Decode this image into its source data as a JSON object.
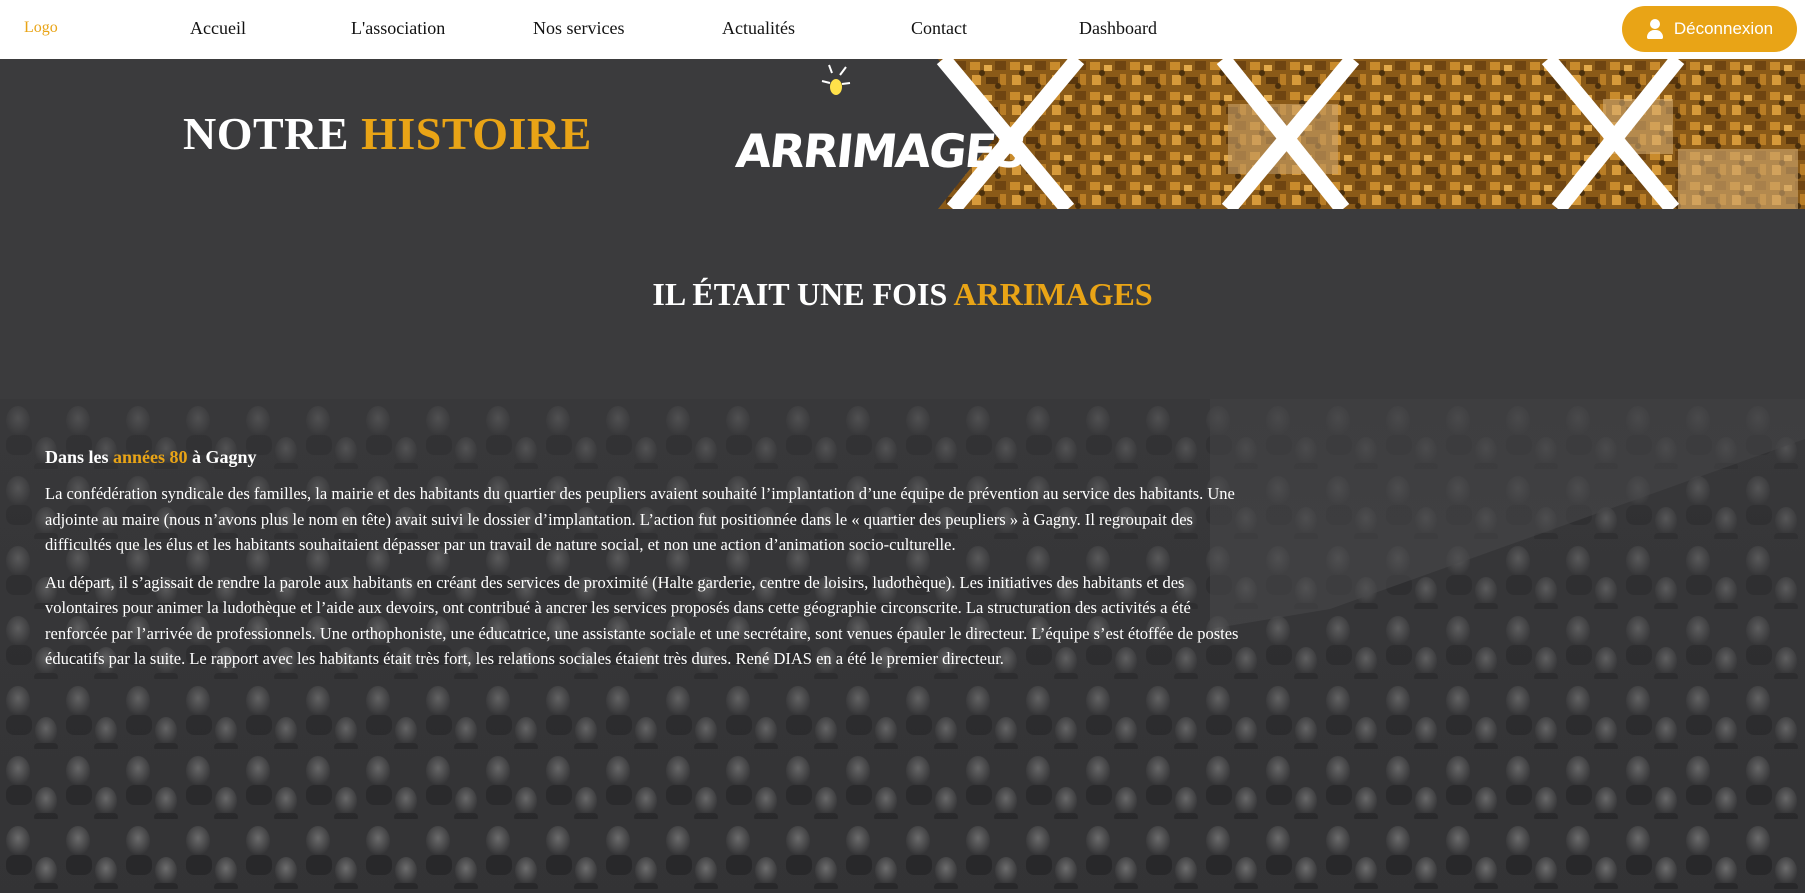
{
  "nav": {
    "logo": "Logo",
    "items": [
      "Accueil",
      "L'association",
      "Nos services",
      "Actualités",
      "Contact",
      "Dashboard"
    ],
    "logout_label": "Déconnexion",
    "logout_icon": "user-icon"
  },
  "hero": {
    "title_part1": "NOTRE ",
    "title_accent": "HISTOIRE",
    "banner_logo_text": "ARRIMAGES"
  },
  "section": {
    "title_part1": "IL ÉTAIT UNE FOIS ",
    "title_accent": "ARRIMAGES"
  },
  "content": {
    "lead_part1": "Dans les ",
    "lead_accent": "années 80",
    "lead_part2": " à Gagny",
    "paragraphs": [
      "La confédération syndicale des familles, la mairie et des habitants du quartier des peupliers avaient souhaité l’implantation d’une équipe de prévention au service des habitants. Une adjointe au maire (nous n’avons plus le nom en tête) avait suivi le dossier d’implantation. L’action fut positionnée dans le « quartier des peupliers » à Gagny. Il regroupait des difficultés que les élus et les habitants souhaitaient dépasser par un travail de nature social, et non une action d’animation socio-culturelle.",
      "Au départ, il s’agissait de rendre la parole aux habitants en créant des services de proximité (Halte garderie, centre de loisirs, ludothèque). Les initiatives des habitants et des volontaires pour animer la ludothèque et l’aide aux devoirs, ont contribué à ancrer les services proposés dans cette géographie circonscrite. La structuration des activités a été renforcée par l’arrivée de professionnels. Une orthophoniste, une éducatrice, une assistante sociale et une secrétaire, sont venues épauler le directeur. L’équipe s’est étoffée de postes éducatifs par la suite. Le rapport avec les habitants était très fort, les relations sociales étaient très dures. René DIAS en a été le premier directeur."
    ]
  },
  "colors": {
    "accent": "#e9a416",
    "dark_bg": "#3b3b3d",
    "nav_bg": "#ffffff"
  }
}
